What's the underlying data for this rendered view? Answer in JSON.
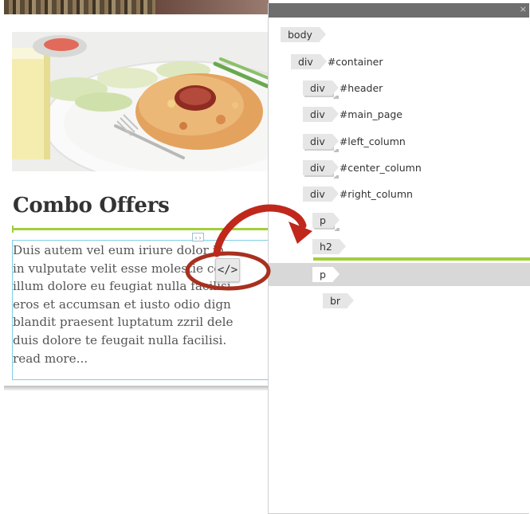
{
  "page": {
    "heading": "Combo Offers",
    "paragraph_lines": [
      "Duis autem vel eum iriure dolor in",
      "in vulputate velit esse molestie con",
      "illum dolore eu feugiat nulla facilisi",
      "eros et accumsan et iusto odio dign",
      "blandit praesent luptatum zzril dele",
      "duis dolore te feugait nulla facilisi.",
      "read more..."
    ],
    "resize_handle_glyph": "‹›",
    "code_tag_glyph": "</>",
    "image_desc_icon": "food-photo"
  },
  "dom_panel": {
    "close_glyph": "×",
    "nodes": [
      {
        "tag": "body",
        "id": ""
      },
      {
        "tag": "div",
        "id": "#container"
      },
      {
        "tag": "div",
        "id": "#header"
      },
      {
        "tag": "div",
        "id": "#main_page"
      },
      {
        "tag": "div",
        "id": "#left_column"
      },
      {
        "tag": "div",
        "id": "#center_column"
      },
      {
        "tag": "div",
        "id": "#right_column"
      },
      {
        "tag": "p",
        "id": ""
      },
      {
        "tag": "h2",
        "id": ""
      },
      {
        "tag": "p",
        "id": ""
      },
      {
        "tag": "br",
        "id": ""
      }
    ]
  },
  "colors": {
    "accent_green": "#a2cf3c",
    "arrow_red": "#c0281c",
    "selection_border": "#7fd0e6",
    "panel_header": "#6e6e6e"
  }
}
